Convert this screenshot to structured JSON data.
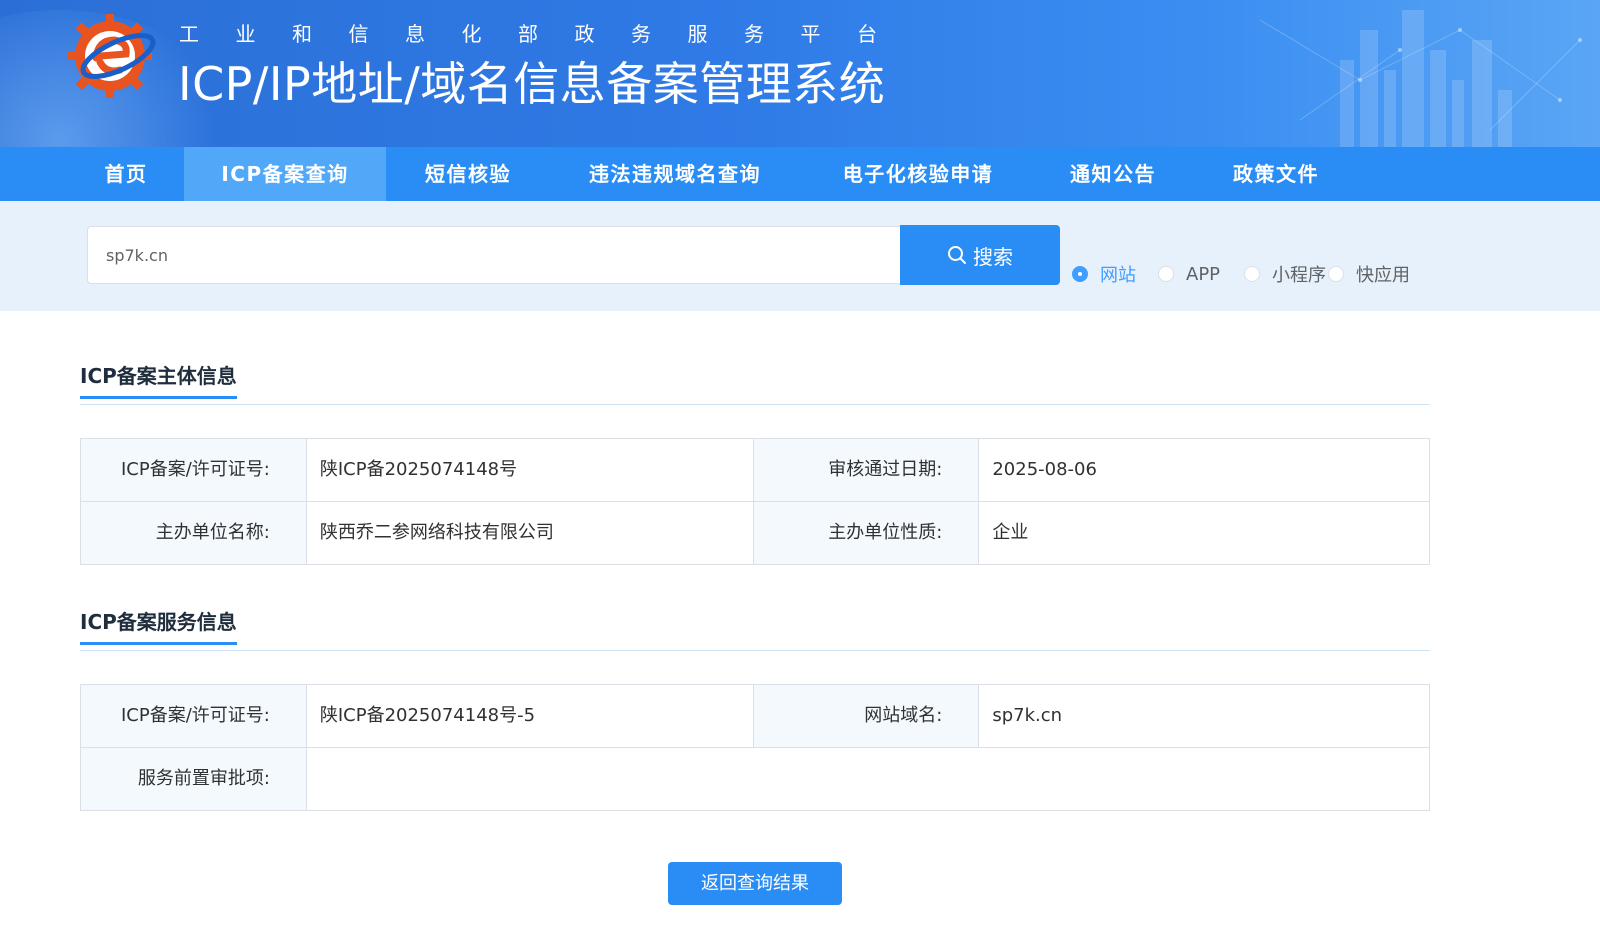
{
  "header": {
    "slogan": "工业和信息化部政务服务平台",
    "system_title": "ICP/IP地址/域名信息备案管理系统"
  },
  "colors": {
    "primary": "#2a8df5",
    "nav_active": "#51a8f8",
    "radio_checked": "#409eff",
    "label_bg": "#f4f9fe",
    "search_band": "#e7f1fc"
  },
  "nav": {
    "items": [
      {
        "label": "首页"
      },
      {
        "label": "ICP备案查询",
        "active": true
      },
      {
        "label": "短信核验"
      },
      {
        "label": "违法违规域名查询"
      },
      {
        "label": "电子化核验申请"
      },
      {
        "label": "通知公告"
      },
      {
        "label": "政策文件"
      }
    ]
  },
  "search": {
    "value": "sp7k.cn",
    "button_label": "搜索",
    "button_icon": "search-icon",
    "types": [
      {
        "label": "网站",
        "checked": true
      },
      {
        "label": "APP",
        "checked": false
      },
      {
        "label": "小程序",
        "checked": false
      },
      {
        "label": "快应用",
        "checked": false
      }
    ]
  },
  "subject_info": {
    "title": "ICP备案主体信息",
    "license_label": "ICP备案/许可证号:",
    "license_value": "陕ICP备2025074148号",
    "approval_date_label": "审核通过日期:",
    "approval_date_value": "2025-08-06",
    "org_name_label": "主办单位名称:",
    "org_name_value": "陕西乔二参网络科技有限公司",
    "org_type_label": "主办单位性质:",
    "org_type_value": "企业"
  },
  "service_info": {
    "title": "ICP备案服务信息",
    "license_label": "ICP备案/许可证号:",
    "license_value": "陕ICP备2025074148号-5",
    "domain_label": "网站域名:",
    "domain_value": "sp7k.cn",
    "pre_approval_label": "服务前置审批项:",
    "pre_approval_value": ""
  },
  "back_button_label": "返回查询结果"
}
